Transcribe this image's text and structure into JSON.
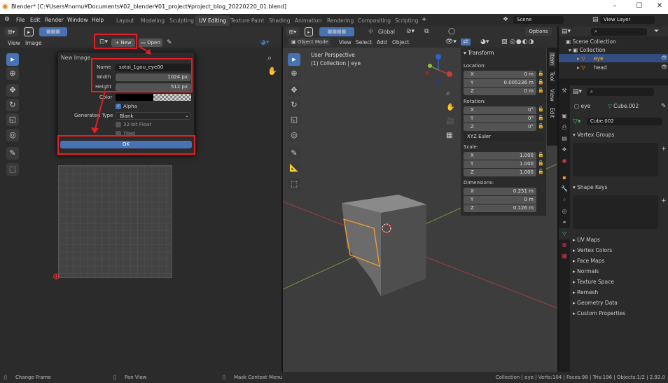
{
  "window": {
    "title": "Blender* [C:¥Users¥nomu¥Documents¥02_blender¥01_project¥project_blog_20220220_01.blend]"
  },
  "menu": [
    "File",
    "Edit",
    "Render",
    "Window",
    "Help"
  ],
  "workspaces": [
    "Layout",
    "Modeling",
    "Sculpting",
    "UV Editing",
    "Texture Paint",
    "Shading",
    "Animation",
    "Rendering",
    "Compositing",
    "Scripting"
  ],
  "active_workspace": "UV Editing",
  "scene": {
    "name": "Scene",
    "view_layer": "View Layer"
  },
  "image_editor": {
    "menus": [
      "View",
      "Image"
    ],
    "new_label": "New",
    "open_label": "Open",
    "dialog": {
      "title": "New Image",
      "name_label": "Name",
      "name_value": "sotai_1gou_eye00",
      "width_label": "Width",
      "width_value": "1024 px",
      "height_label": "Height",
      "height_value": "512 px",
      "color_label": "Color",
      "alpha_label": "Alpha",
      "generated_type_label": "Generated Type",
      "generated_type_value": "Blank",
      "float_label": "32-bit Float",
      "tiled_label": "Tiled",
      "ok_label": "OK"
    }
  },
  "viewport": {
    "mode": "Object Mode",
    "menus": [
      "View",
      "Select",
      "Add",
      "Object"
    ],
    "transform_orientation": "Global",
    "options_label": "Options",
    "perspective": "User Perspective",
    "collection_info": "(1) Collection | eye"
  },
  "npanel": {
    "title": "Transform",
    "tabs": [
      "Item",
      "Tool",
      "View",
      "Edit"
    ],
    "location_label": "Location:",
    "location": [
      {
        "axis": "X",
        "value": "0 m"
      },
      {
        "axis": "Y",
        "value": "0.005236 m"
      },
      {
        "axis": "Z",
        "value": "0 m"
      }
    ],
    "rotation_label": "Rotation:",
    "rotation": [
      {
        "axis": "X",
        "value": "0°"
      },
      {
        "axis": "Y",
        "value": "0°"
      },
      {
        "axis": "Z",
        "value": "0°"
      }
    ],
    "rotation_mode": "XYZ Euler",
    "scale_label": "Scale:",
    "scale": [
      {
        "axis": "X",
        "value": "1.000"
      },
      {
        "axis": "Y",
        "value": "1.000"
      },
      {
        "axis": "Z",
        "value": "1.000"
      }
    ],
    "dimensions_label": "Dimensions:",
    "dimensions": [
      {
        "axis": "X",
        "value": "0.251 m"
      },
      {
        "axis": "Y",
        "value": "0 m"
      },
      {
        "axis": "Z",
        "value": "0.126 m"
      }
    ]
  },
  "outliner": {
    "scene_collection": "Scene Collection",
    "collection": "Collection",
    "items": [
      "eye",
      "head"
    ]
  },
  "properties": {
    "object_name": "eye",
    "data_name": "Cube.002",
    "mesh_name": "Cube.002",
    "vertex_groups": "Vertex Groups",
    "shape_keys": "Shape Keys",
    "panels": [
      "UV Maps",
      "Vertex Colors",
      "Face Maps",
      "Normals",
      "Texture Space",
      "Remesh",
      "Geometry Data",
      "Custom Properties"
    ]
  },
  "statusbar": {
    "left": "Change Frame",
    "middle": "Pan View",
    "right_hint": "Mask Context Menu",
    "stats": "Collection | eye | Verts:104 | Faces:98 | Tris:196 | Objects:1/2 | 2.92.0"
  },
  "colors": {
    "accent": "#4772b3",
    "highlight": "#e21f25",
    "selection": "#f09a2c"
  }
}
